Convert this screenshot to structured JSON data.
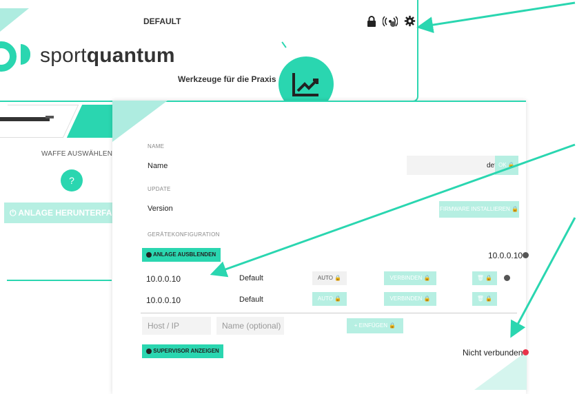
{
  "back_window": {
    "title": "DEFAULT",
    "logo_text_light": "sport",
    "logo_text_bold": "quantum",
    "tagline": "Werkzeuge für die Praxis"
  },
  "icons": [
    "lock-icon",
    "wireless-icon",
    "gear-icon"
  ],
  "left_panel": {
    "weapon_label": "WAFFE AUSWÄHLEN",
    "help_button": "?",
    "shutdown_label": "ANLAGE HERUNTERFAHR"
  },
  "settings": {
    "name_section": "NAME",
    "name_label": "Name",
    "name_value": "default",
    "ok_button": "OK",
    "update_section": "UPDATE",
    "version_label": "Version",
    "firmware_button": "FIRMWARE INSTALLIEREN",
    "device_section": "GERÄTEKONFIGURATION",
    "hide_button": "ANLAGE AUSBLENDEN",
    "current_ip": "10.0.0.10",
    "rows": [
      {
        "ip": "10.0.0.10",
        "name": "Default",
        "auto": "AUTO",
        "connect": "VERBINDEN"
      },
      {
        "ip": "10.0.0.10",
        "name": "Default",
        "auto": "AUTO",
        "connect": "VERBINDEN"
      }
    ],
    "host_placeholder": "Host / IP",
    "name_placeholder": "Name (optional)",
    "insert_button": "+ EINFÜGEN",
    "supervisor_button": "SUPERVISOR ANZEIGEN",
    "status": "Nicht verbunden"
  },
  "colors": {
    "accent": "#2ad6b0",
    "accent_light": "#b6efe2",
    "error": "#e8334a"
  }
}
